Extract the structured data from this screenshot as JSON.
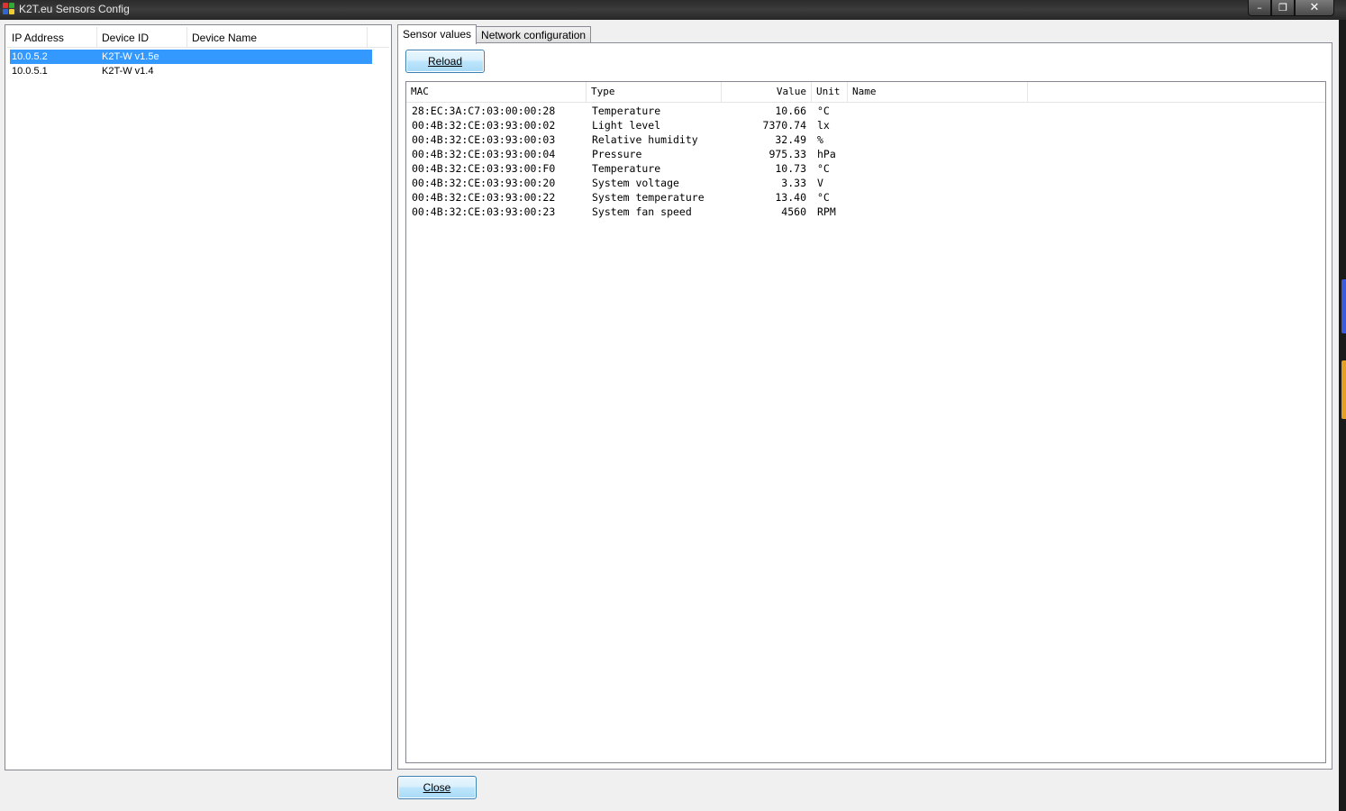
{
  "window": {
    "title": "K2T.eu Sensors Config",
    "minimize": "–",
    "maximize": "❐",
    "close": "✕"
  },
  "devices": {
    "columns": [
      "IP Address",
      "Device ID",
      "Device Name"
    ],
    "rows": [
      {
        "ip": "10.0.5.2",
        "id": "K2T-W v1.5e",
        "name": "",
        "selected": true
      },
      {
        "ip": "10.0.5.1",
        "id": "K2T-W v1.4",
        "name": "",
        "selected": false
      }
    ]
  },
  "tabs": [
    {
      "label": "Sensor values",
      "active": true
    },
    {
      "label": "Network configuration",
      "active": false
    }
  ],
  "sensor_panel": {
    "reload_label": "Reload",
    "columns": [
      "MAC",
      "Type",
      "Value",
      "Unit",
      "Name"
    ],
    "rows": [
      {
        "mac": "28:EC:3A:C7:03:00:00:28",
        "type": "Temperature",
        "value": "10.66",
        "unit": "°C",
        "name": ""
      },
      {
        "mac": "00:4B:32:CE:03:93:00:02",
        "type": "Light level",
        "value": "7370.74",
        "unit": "lx",
        "name": ""
      },
      {
        "mac": "00:4B:32:CE:03:93:00:03",
        "type": "Relative humidity",
        "value": "32.49",
        "unit": "%",
        "name": ""
      },
      {
        "mac": "00:4B:32:CE:03:93:00:04",
        "type": "Pressure",
        "value": "975.33",
        "unit": "hPa",
        "name": ""
      },
      {
        "mac": "00:4B:32:CE:03:93:00:F0",
        "type": "Temperature",
        "value": "10.73",
        "unit": "°C",
        "name": ""
      },
      {
        "mac": "00:4B:32:CE:03:93:00:20",
        "type": "System voltage",
        "value": "3.33",
        "unit": "V",
        "name": ""
      },
      {
        "mac": "00:4B:32:CE:03:93:00:22",
        "type": "System temperature",
        "value": "13.40",
        "unit": "°C",
        "name": ""
      },
      {
        "mac": "00:4B:32:CE:03:93:00:23",
        "type": "System fan speed",
        "value": "4560",
        "unit": "RPM",
        "name": ""
      }
    ]
  },
  "footer": {
    "close_label": "Close"
  },
  "colors": {
    "selection": "#3399ff",
    "button_border": "#3c7fb1"
  }
}
